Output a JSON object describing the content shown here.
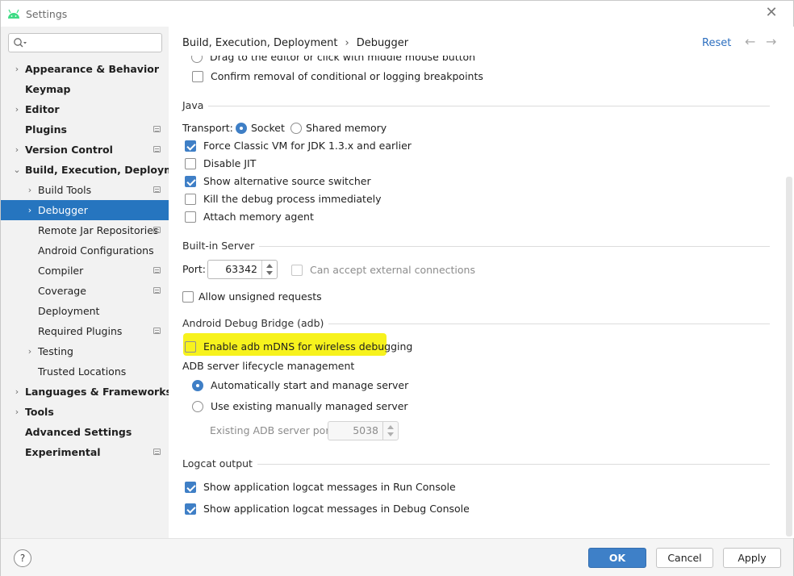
{
  "window": {
    "title": "Settings",
    "close_icon": "close-icon"
  },
  "sidebar": {
    "search_placeholder": "",
    "items": [
      {
        "label": "Appearance & Behavior",
        "arrow": "›",
        "level": 0,
        "project": false
      },
      {
        "label": "Keymap",
        "arrow": "",
        "level": 0,
        "project": false
      },
      {
        "label": "Editor",
        "arrow": "›",
        "level": 0,
        "project": false
      },
      {
        "label": "Plugins",
        "arrow": "",
        "level": 0,
        "project": true
      },
      {
        "label": "Version Control",
        "arrow": "›",
        "level": 0,
        "project": true
      },
      {
        "label": "Build, Execution, Deployment",
        "arrow": "⌄",
        "level": 0,
        "project": false
      },
      {
        "label": "Build Tools",
        "arrow": "›",
        "level": 1,
        "project": true
      },
      {
        "label": "Debugger",
        "arrow": "›",
        "level": 1,
        "project": false,
        "selected": true
      },
      {
        "label": "Remote Jar Repositories",
        "arrow": "",
        "level": 1,
        "project": true
      },
      {
        "label": "Android Configurations",
        "arrow": "",
        "level": 1,
        "project": false
      },
      {
        "label": "Compiler",
        "arrow": "",
        "level": 1,
        "project": true
      },
      {
        "label": "Coverage",
        "arrow": "",
        "level": 1,
        "project": true
      },
      {
        "label": "Deployment",
        "arrow": "",
        "level": 1,
        "project": false
      },
      {
        "label": "Required Plugins",
        "arrow": "",
        "level": 1,
        "project": true
      },
      {
        "label": "Testing",
        "arrow": "›",
        "level": 1,
        "project": false
      },
      {
        "label": "Trusted Locations",
        "arrow": "",
        "level": 1,
        "project": false
      },
      {
        "label": "Languages & Frameworks",
        "arrow": "›",
        "level": 0,
        "project": false
      },
      {
        "label": "Tools",
        "arrow": "›",
        "level": 0,
        "project": false
      },
      {
        "label": "Advanced Settings",
        "arrow": "",
        "level": 0,
        "project": false
      },
      {
        "label": "Experimental",
        "arrow": "",
        "level": 0,
        "project": true
      }
    ]
  },
  "header": {
    "breadcrumb_parent": "Build, Execution, Deployment",
    "breadcrumb_sep": "›",
    "breadcrumb_current": "Debugger",
    "reset": "Reset",
    "back": "←",
    "forward": "→"
  },
  "content": {
    "drag_option": "Drag to the editor or click with middle mouse button",
    "confirm_removal": "Confirm removal of conditional or logging breakpoints",
    "java": {
      "title": "Java",
      "transport_label": "Transport:",
      "socket": "Socket",
      "shared_memory": "Shared memory",
      "force_classic": "Force Classic VM for JDK 1.3.x and earlier",
      "disable_jit": "Disable JIT",
      "show_alt": "Show alternative source switcher",
      "kill_debug": "Kill the debug process immediately",
      "attach_memory": "Attach memory agent"
    },
    "server": {
      "title": "Built-in Server",
      "port_label": "Port:",
      "port_value": "63342",
      "external": "Can accept external connections",
      "unsigned": "Allow unsigned requests"
    },
    "adb": {
      "title": "Android Debug Bridge (adb)",
      "mdns": "Enable adb mDNS for wireless debugging",
      "lifecycle": "ADB server lifecycle management",
      "auto": "Automatically start and manage server",
      "existing": "Use existing manually managed server",
      "port_label": "Existing ADB server port:",
      "port_value": "5038"
    },
    "logcat": {
      "title": "Logcat output",
      "run": "Show application logcat messages in Run Console",
      "debug": "Show application logcat messages in Debug Console"
    }
  },
  "footer": {
    "help": "?",
    "ok": "OK",
    "cancel": "Cancel",
    "apply": "Apply"
  },
  "colors": {
    "selection": "#2675bf",
    "accent": "#3f7fc6",
    "highlight": "#f7f21d",
    "link": "#2d6fbf"
  }
}
